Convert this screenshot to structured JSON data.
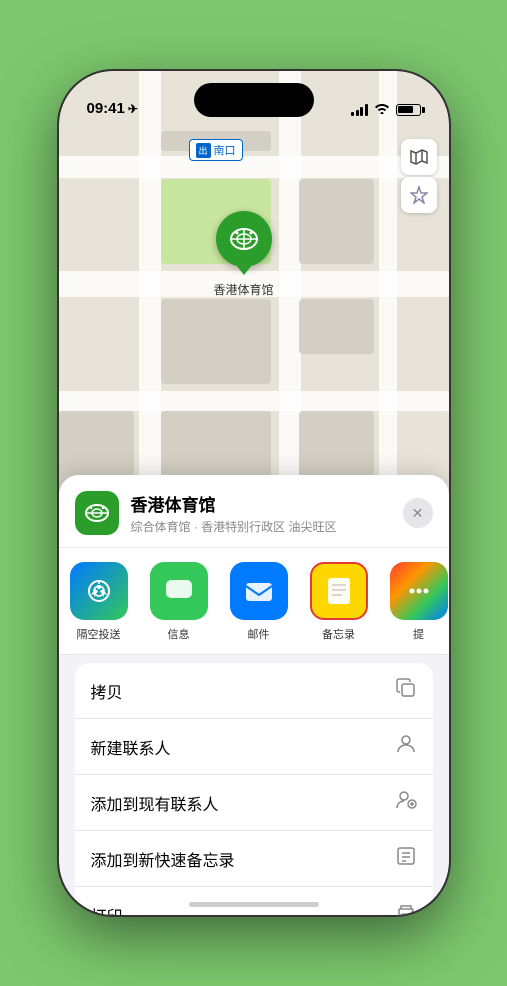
{
  "status": {
    "time": "09:41",
    "arrow": "▶"
  },
  "map": {
    "label_text": "南口",
    "venue_pin_label": "香港体育馆"
  },
  "venue": {
    "name": "香港体育馆",
    "subtitle": "综合体育馆 · 香港特别行政区 油尖旺区"
  },
  "share_items": [
    {
      "id": "airdrop",
      "label": "隔空投送",
      "type": "airdrop"
    },
    {
      "id": "messages",
      "label": "信息",
      "type": "messages"
    },
    {
      "id": "mail",
      "label": "邮件",
      "type": "mail"
    },
    {
      "id": "notes",
      "label": "备忘录",
      "type": "notes",
      "selected": true
    },
    {
      "id": "more",
      "label": "提",
      "type": "more"
    }
  ],
  "actions": [
    {
      "id": "copy",
      "label": "拷贝",
      "icon": "copy"
    },
    {
      "id": "add-contact",
      "label": "新建联系人",
      "icon": "person"
    },
    {
      "id": "add-existing",
      "label": "添加到现有联系人",
      "icon": "person-add"
    },
    {
      "id": "add-note",
      "label": "添加到新快速备忘录",
      "icon": "note"
    },
    {
      "id": "print",
      "label": "打印",
      "icon": "print"
    }
  ],
  "controls": {
    "map_btn": "🗺",
    "nav_btn": "⬆"
  }
}
